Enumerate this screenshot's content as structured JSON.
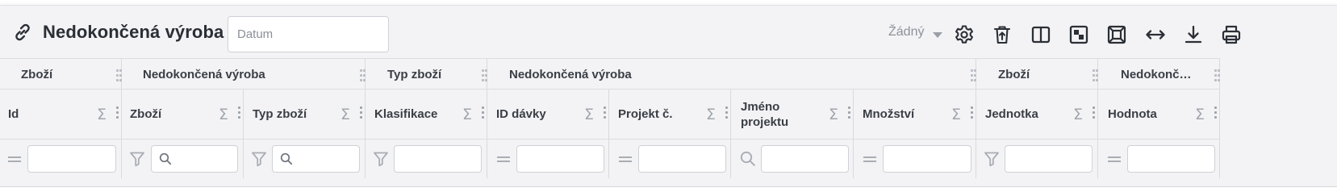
{
  "header": {
    "title": "Nedokončená výroba",
    "date_placeholder": "Datum",
    "layout_select": "Žádný"
  },
  "toolbar": {
    "icons": [
      "gear-icon",
      "delete-icon",
      "split-view-icon",
      "toggle-panel-icon",
      "fit-screen-icon",
      "expand-width-icon",
      "download-icon",
      "print-icon"
    ]
  },
  "grid": {
    "groups": [
      "Zboží",
      "Nedokončená výroba",
      "Typ zboží",
      "Nedokončená výroba",
      "Zboží",
      "Nedokonč…"
    ],
    "columns": [
      {
        "label": "Id",
        "filter": "equals"
      },
      {
        "label": "Zboží",
        "filter": "filter-search"
      },
      {
        "label": "Typ zboží",
        "filter": "filter-search"
      },
      {
        "label": "Klasifikace",
        "filter": "filter"
      },
      {
        "label": "ID dávky",
        "filter": "equals"
      },
      {
        "label": "Projekt č.",
        "filter": "equals"
      },
      {
        "label": "Jméno projektu",
        "filter": "search"
      },
      {
        "label": "Množství",
        "filter": "equals"
      },
      {
        "label": "Jednotka",
        "filter": "filter"
      },
      {
        "label": "Hodnota",
        "filter": "equals"
      }
    ],
    "sum_symbol": "Σ"
  }
}
